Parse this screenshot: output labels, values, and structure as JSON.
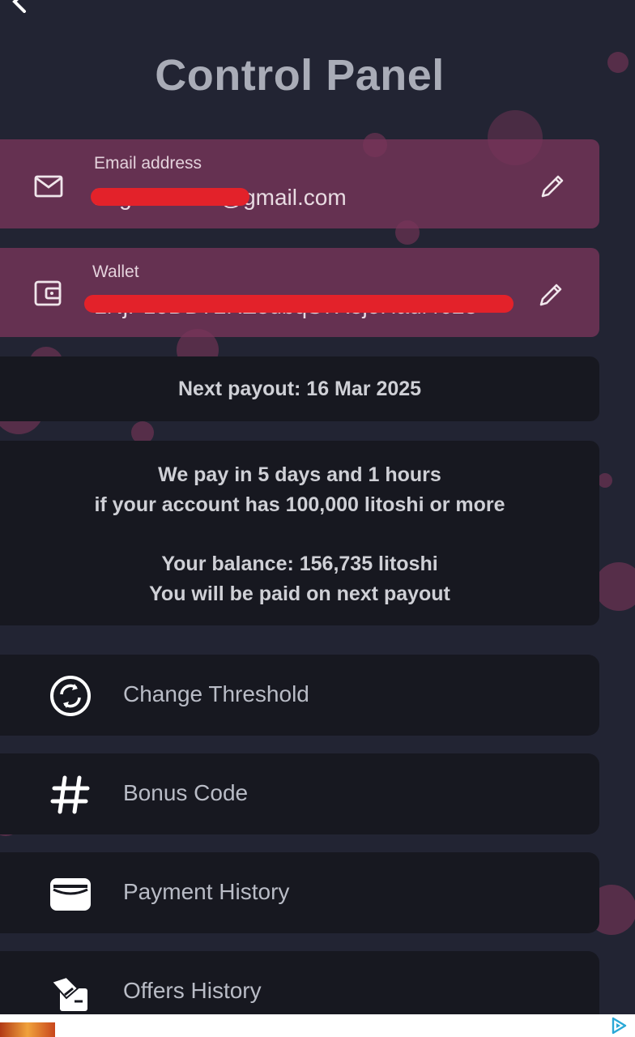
{
  "header": {
    "title": "Control Panel"
  },
  "fields": {
    "email": {
      "label": "Email address",
      "value": "hagdam...07@gmail.com"
    },
    "wallet": {
      "label": "Wallet",
      "value": "LNjP1oDD72RZ8dbqS7X3joHadl4623"
    }
  },
  "payout": {
    "next": "Next payout: 16 Mar 2025"
  },
  "info": {
    "line1": "We pay in 5 days and 1 hours",
    "line2": "if your account has 100,000 litoshi or more",
    "line3": "Your balance: 156,735 litoshi",
    "line4": "You will be paid on next payout"
  },
  "menu": {
    "items": [
      {
        "label": "Change Threshold",
        "icon": "refresh-circle-icon"
      },
      {
        "label": "Bonus Code",
        "icon": "hashtag-icon"
      },
      {
        "label": "Payment History",
        "icon": "wallet-card-icon"
      },
      {
        "label": "Offers History",
        "icon": "offers-icon"
      }
    ]
  },
  "colors": {
    "background": "#222433",
    "field_card": "#78345a",
    "dark_card": "#171820",
    "redaction": "#e3222a",
    "title": "#a9acb7"
  }
}
